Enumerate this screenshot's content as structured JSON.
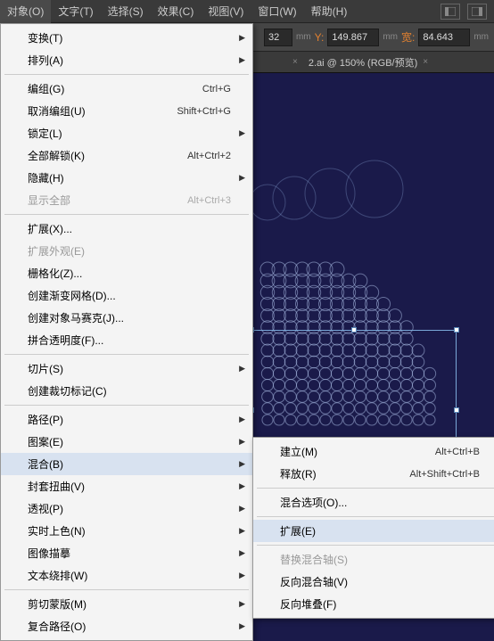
{
  "menubar": {
    "items": [
      "对象(O)",
      "文字(T)",
      "选择(S)",
      "效果(C)",
      "视图(V)",
      "窗口(W)",
      "帮助(H)"
    ]
  },
  "toolbar": {
    "x_val": "32",
    "unit1": "mm",
    "y_label": "Y:",
    "y_val": "149.867",
    "unit2": "mm",
    "w_label": "宽:",
    "w_val": "84.643",
    "unit3": "mm"
  },
  "tab": {
    "title": "2.ai @ 150% (RGB/预览)"
  },
  "dropdown": [
    {
      "label": "变换(T)",
      "arrow": true
    },
    {
      "label": "排列(A)",
      "arrow": true
    },
    {
      "sep": true
    },
    {
      "label": "编组(G)",
      "shortcut": "Ctrl+G"
    },
    {
      "label": "取消编组(U)",
      "shortcut": "Shift+Ctrl+G"
    },
    {
      "label": "锁定(L)",
      "arrow": true
    },
    {
      "label": "全部解锁(K)",
      "shortcut": "Alt+Ctrl+2"
    },
    {
      "label": "隐藏(H)",
      "arrow": true
    },
    {
      "label": "显示全部",
      "shortcut": "Alt+Ctrl+3",
      "disabled": true
    },
    {
      "sep": true
    },
    {
      "label": "扩展(X)..."
    },
    {
      "label": "扩展外观(E)",
      "disabled": true
    },
    {
      "label": "栅格化(Z)..."
    },
    {
      "label": "创建渐变网格(D)..."
    },
    {
      "label": "创建对象马赛克(J)..."
    },
    {
      "label": "拼合透明度(F)..."
    },
    {
      "sep": true
    },
    {
      "label": "切片(S)",
      "arrow": true
    },
    {
      "label": "创建裁切标记(C)"
    },
    {
      "sep": true
    },
    {
      "label": "路径(P)",
      "arrow": true
    },
    {
      "label": "图案(E)",
      "arrow": true
    },
    {
      "label": "混合(B)",
      "arrow": true,
      "hover": true
    },
    {
      "label": "封套扭曲(V)",
      "arrow": true
    },
    {
      "label": "透视(P)",
      "arrow": true
    },
    {
      "label": "实时上色(N)",
      "arrow": true
    },
    {
      "label": "图像描摹",
      "arrow": true
    },
    {
      "label": "文本绕排(W)",
      "arrow": true
    },
    {
      "sep": true
    },
    {
      "label": "剪切蒙版(M)",
      "arrow": true
    },
    {
      "label": "复合路径(O)",
      "arrow": true
    }
  ],
  "submenu": [
    {
      "label": "建立(M)",
      "shortcut": "Alt+Ctrl+B"
    },
    {
      "label": "释放(R)",
      "shortcut": "Alt+Shift+Ctrl+B"
    },
    {
      "sep": true
    },
    {
      "label": "混合选项(O)..."
    },
    {
      "sep": true
    },
    {
      "label": "扩展(E)",
      "hover": true
    },
    {
      "sep": true
    },
    {
      "label": "替换混合轴(S)",
      "disabled": true
    },
    {
      "label": "反向混合轴(V)"
    },
    {
      "label": "反向堆叠(F)"
    }
  ]
}
